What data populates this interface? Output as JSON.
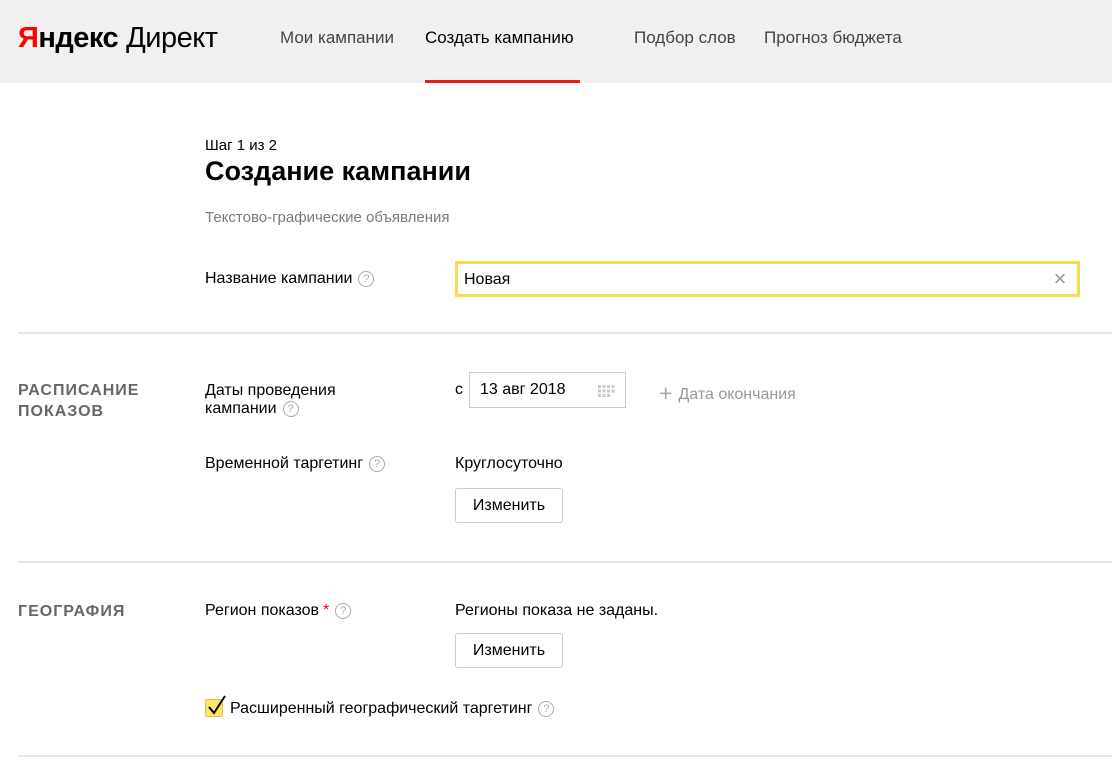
{
  "header": {
    "logo": {
      "brand_first": "Я",
      "brand_rest": "ндекс",
      "product": "Директ"
    },
    "nav": [
      {
        "label": "Мои кампании"
      },
      {
        "label": "Создать кампанию",
        "active": true
      },
      {
        "label": "Подбор слов"
      },
      {
        "label": "Прогноз бюджета"
      }
    ]
  },
  "page": {
    "step": "Шаг 1 из 2",
    "title": "Создание кампании",
    "subtitle": "Текстово-графические объявления"
  },
  "campaign_name": {
    "label": "Название кампании",
    "value": "Новая"
  },
  "schedule": {
    "section_title_line1": "РАСПИСАНИЕ",
    "section_title_line2": "ПОКАЗОВ",
    "dates_label_line1": "Даты проведения",
    "dates_label_line2": "кампании",
    "date_prefix": "с",
    "start_date": "13 авг 2018",
    "add_end_date": "Дата окончания",
    "time_targeting_label": "Временной таргетинг",
    "time_targeting_value": "Круглосуточно",
    "change_button": "Изменить"
  },
  "geography": {
    "section_title": "ГЕОГРАФИЯ",
    "region_label": "Регион показов",
    "required_mark": "*",
    "region_value": "Регионы показа не заданы.",
    "change_button": "Изменить",
    "extended_targeting_label": "Расширенный географический таргетинг",
    "extended_targeting_checked": true
  },
  "icons": {
    "help": "?",
    "clear": "×",
    "plus": "+"
  },
  "colors": {
    "header_bg": "#f2f1f0",
    "accent_red": "#e02020",
    "input_focus": "#f2de54",
    "checkbox_yellow": "#fde46c"
  }
}
